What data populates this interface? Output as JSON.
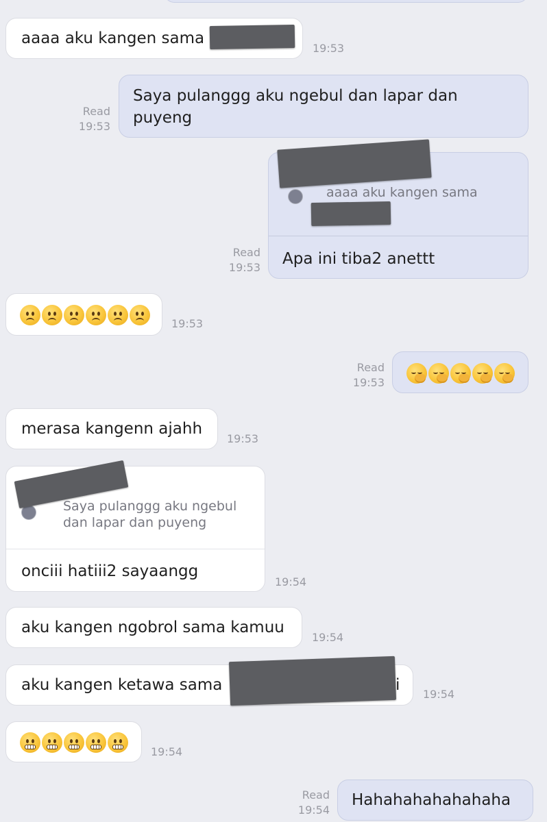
{
  "messages": {
    "m1": {
      "text": "aaaa aku kangen sama",
      "time": "19:53"
    },
    "m2": {
      "text_line1": "Saya pulanggg aku ngebul dan lapar dan",
      "text_line2": "puyeng",
      "status": "Read",
      "time": "19:53"
    },
    "m3": {
      "quote": "aaaa aku kangen sama",
      "text": "Apa ini tiba2 anettt",
      "status": "Read",
      "time": "19:53"
    },
    "m4": {
      "emoji": [
        "frowning-face",
        "frowning-face",
        "frowning-face",
        "frowning-face",
        "frowning-face",
        "frowning-face"
      ],
      "time": "19:53"
    },
    "m5": {
      "emoji": [
        "face-with-hand-over-mouth",
        "face-with-hand-over-mouth",
        "face-with-hand-over-mouth",
        "face-with-hand-over-mouth",
        "face-with-hand-over-mouth"
      ],
      "status": "Read",
      "time": "19:53"
    },
    "m6": {
      "text": "merasa kangenn ajahh",
      "time": "19:53"
    },
    "m7": {
      "quote_line1": "Saya pulanggg aku ngebul",
      "quote_line2": "dan lapar dan puyeng",
      "text": "onciii hatiii2 sayaangg",
      "time": "19:54"
    },
    "m8": {
      "text": "aku kangen ngobrol sama kamuu",
      "time": "19:54"
    },
    "m9": {
      "text": "aku kangen ketawa sama",
      "tail": "i",
      "time": "19:54"
    },
    "m10": {
      "emoji": [
        "grimacing-face",
        "grimacing-face",
        "grimacing-face",
        "grimacing-face",
        "grimacing-face"
      ],
      "time": "19:54"
    },
    "m11": {
      "text": "Hahahahahahahaha",
      "status": "Read",
      "time": "19:54"
    }
  },
  "colors": {
    "background": "#ecedf2",
    "incoming_bubble": "#ffffff",
    "outgoing_bubble": "#dfe3f3",
    "meta_text": "#999aa2",
    "redaction": "#5c5d61"
  }
}
